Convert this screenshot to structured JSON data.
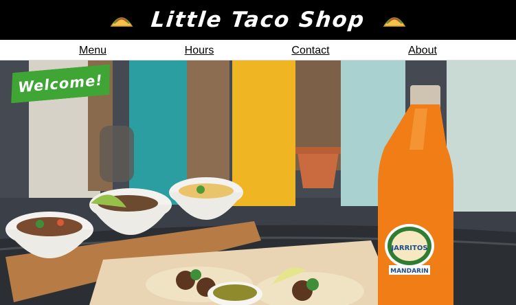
{
  "header": {
    "title": "Little Taco Shop",
    "left_icon": "taco-icon",
    "right_icon": "taco-icon"
  },
  "nav": {
    "items": [
      {
        "label": "Menu"
      },
      {
        "label": "Hours"
      },
      {
        "label": "Contact"
      },
      {
        "label": "About"
      }
    ]
  },
  "hero": {
    "badge": "Welcome!",
    "bottle_brand": "JARRITOS",
    "bottle_flavor": "MANDARIN"
  },
  "colors": {
    "header_bg": "#000000",
    "nav_bg": "#ffffff",
    "badge_green": "#3fa535"
  }
}
